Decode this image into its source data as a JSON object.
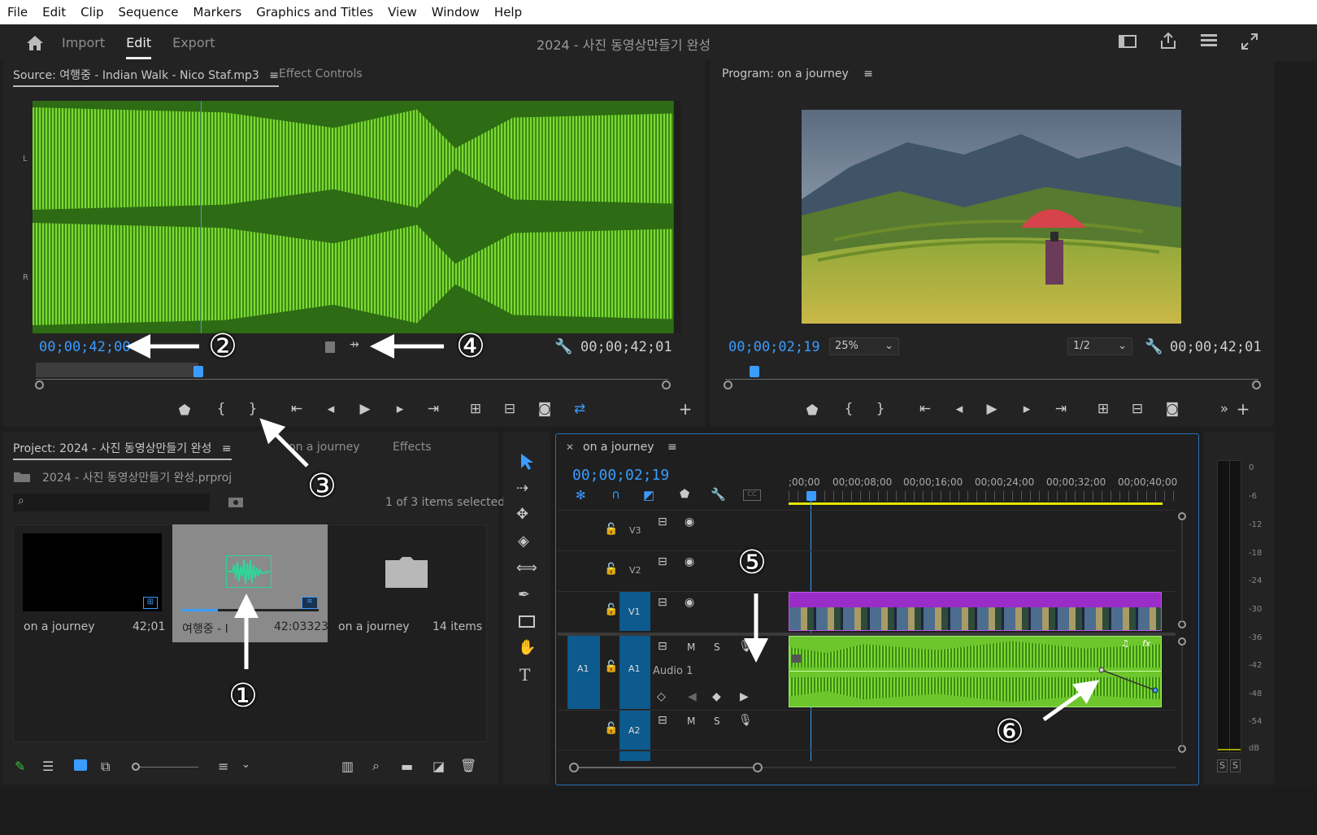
{
  "menu": [
    "File",
    "Edit",
    "Clip",
    "Sequence",
    "Markers",
    "Graphics and Titles",
    "View",
    "Window",
    "Help"
  ],
  "header": {
    "import": "Import",
    "edit": "Edit",
    "export": "Export",
    "project_title": "2024 - 사진 동영상만들기 완성"
  },
  "source": {
    "tab_label": "Source: 여행중 - Indian Walk - Nico Staf.mp3",
    "effect_controls": "Effect Controls",
    "channel_left": "L",
    "channel_right": "R",
    "timecode_in": "00;00;42;00",
    "timecode_duration": "00;00;42;01"
  },
  "program": {
    "tab_label": "Program: on a journey",
    "timecode": "00;00;02;19",
    "zoom": "25%",
    "resolution": "1/2",
    "duration": "00;00;42;01"
  },
  "project": {
    "tab_label": "Project: 2024 - 사진 동영상만들기 완성",
    "tab2": "on a journey",
    "tab3": "Effects",
    "file_name": "2024 - 사진 동영상만들기 완성.prproj",
    "selection_info": "1 of 3 items selected",
    "items": [
      {
        "name": "on a journey",
        "meta": "42;01"
      },
      {
        "name": "여행중 - I",
        "meta": "42:03323"
      },
      {
        "name": "on a journey",
        "meta": "14 items"
      }
    ]
  },
  "timeline": {
    "tab_label": "on a journey",
    "timecode": "00;00;02;19",
    "ruler": [
      ";00;00",
      "00;00;08;00",
      "00;00;16;00",
      "00;00;24;00",
      "00;00;32;00",
      "00;00;40;00"
    ],
    "tracks": [
      "V3",
      "V2",
      "V1",
      "A1",
      "A2"
    ],
    "audio_track_name": "Audio 1",
    "src_patch": "A1",
    "m": "M",
    "s": "S"
  },
  "meter": {
    "scale": [
      "0",
      "-6",
      "-12",
      "-18",
      "-24",
      "-30",
      "-36",
      "-42",
      "-48",
      "-54",
      "dB"
    ],
    "solo_l": "S",
    "solo_r": "S"
  },
  "annotations": [
    "②",
    "④",
    "③",
    "①",
    "⑤",
    "⑥"
  ],
  "colors": {
    "accent": "#3b9cff",
    "waveform": "#7cd934",
    "video_clip": "#9a2cc8",
    "patch": "#0d5a8e"
  }
}
